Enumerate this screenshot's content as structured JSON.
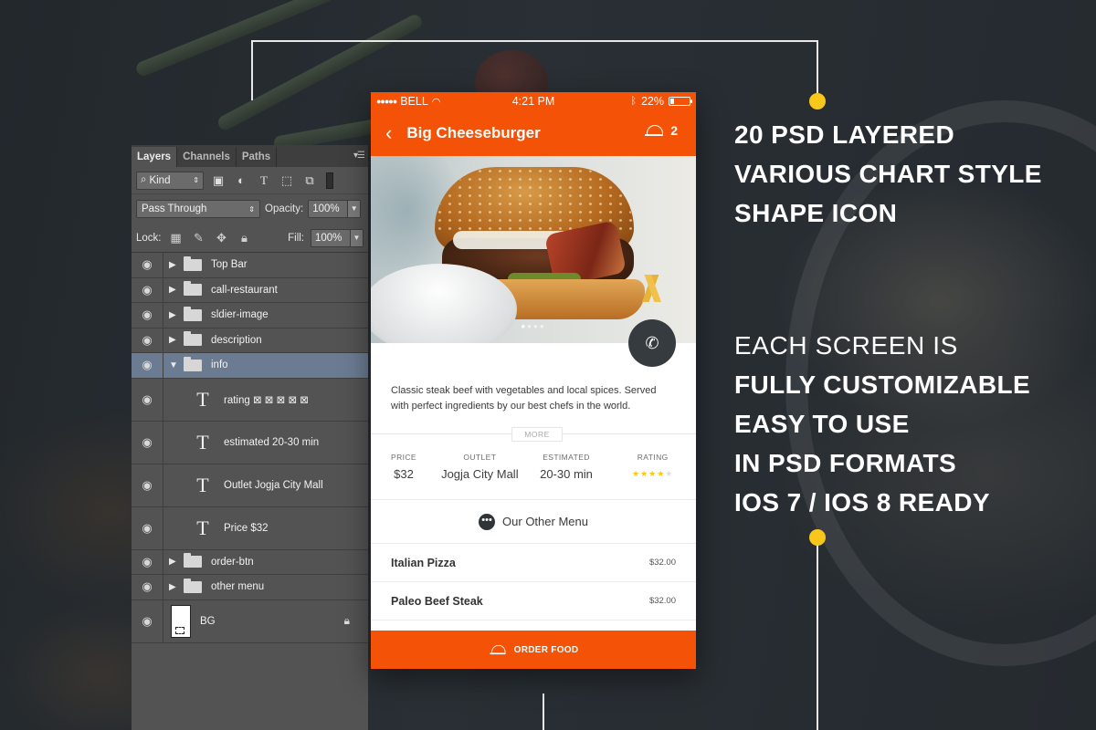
{
  "layers_panel": {
    "tabs": [
      "Layers",
      "Channels",
      "Paths"
    ],
    "active_tab": "Layers",
    "kind_label": "Kind",
    "blend_mode": "Pass Through",
    "opacity_label": "Opacity:",
    "opacity_value": "100%",
    "lock_label": "Lock:",
    "fill_label": "Fill:",
    "fill_value": "100%",
    "layers": [
      {
        "name": "Top Bar",
        "type": "group",
        "expanded": false
      },
      {
        "name": "call-restaurant",
        "type": "group",
        "expanded": false
      },
      {
        "name": "sldier-image",
        "type": "group",
        "expanded": false
      },
      {
        "name": "description",
        "type": "group",
        "expanded": false
      },
      {
        "name": "info",
        "type": "group",
        "expanded": true,
        "selected": true
      },
      {
        "name": "rating ⊠ ⊠ ⊠ ⊠ ⊠",
        "type": "text"
      },
      {
        "name": "estimated 20-30 min",
        "type": "text"
      },
      {
        "name": "Outlet Jogja City Mall",
        "type": "text"
      },
      {
        "name": "Price $32",
        "type": "text"
      },
      {
        "name": "order-btn",
        "type": "group",
        "expanded": false
      },
      {
        "name": "other menu",
        "type": "group",
        "expanded": false
      },
      {
        "name": "BG",
        "type": "background",
        "locked": true
      }
    ]
  },
  "phone": {
    "status": {
      "carrier": "BELL",
      "time": "4:21 PM",
      "battery": "22%",
      "battery_level": 0.22
    },
    "nav": {
      "title": "Big Cheeseburger",
      "cart_count": "2"
    },
    "slider": {
      "pages": 4,
      "active_page": 1
    },
    "description": "Classic steak beef with vegetables and local spices.  Served with perfect ingredients by our best chefs in the world.",
    "more_label": "MORE",
    "info": [
      {
        "label": "PRICE",
        "value": "$32"
      },
      {
        "label": "OUTLET",
        "value": "Jogja City Mall"
      },
      {
        "label": "ESTIMATED",
        "value": "20-30 min"
      },
      {
        "label": "RATING",
        "rating": 4,
        "max": 5
      }
    ],
    "other_menu_label": "Our Other Menu",
    "menu_items": [
      {
        "name": "Italian Pizza",
        "price": "$32.00"
      },
      {
        "name": "Paleo Beef Steak",
        "price": "$32.00"
      }
    ],
    "order_label": "ORDER FOOD"
  },
  "features": [
    "20 PSD LAYERED",
    "VARIOUS CHART STYLE",
    "SHAPE ICON"
  ],
  "bullets": {
    "intro": "EACH SCREEN IS",
    "items": [
      "FULLY CUSTOMIZABLE",
      "EASY TO USE",
      "IN PSD FORMATS",
      "IOS 7 / IOS 8 READY"
    ]
  },
  "colors": {
    "accent": "#f45207",
    "highlight": "#f7c81b",
    "selected_layer": "#6b7b92"
  }
}
